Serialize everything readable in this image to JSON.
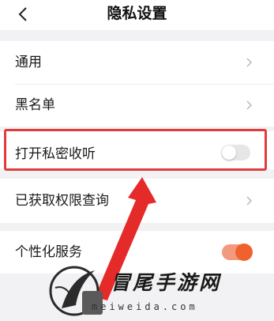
{
  "header": {
    "title": "隐私设置",
    "back_icon": "chevron-left-icon"
  },
  "settings": {
    "general_label": "通用",
    "blacklist_label": "黑名单",
    "private_listen_label": "打开私密收听",
    "private_listen_enabled": false,
    "permissions_label": "已获取权限查询",
    "personalized_label": "个性化服务",
    "personalized_enabled": true
  },
  "watermark": {
    "title": "冒尾手游网",
    "url": "meiweida.com"
  },
  "colors": {
    "highlight": "#e23b3b",
    "toggle_on": "#f0622d",
    "toggle_off": "#e6e6e6",
    "background": "#f2f2f4"
  }
}
